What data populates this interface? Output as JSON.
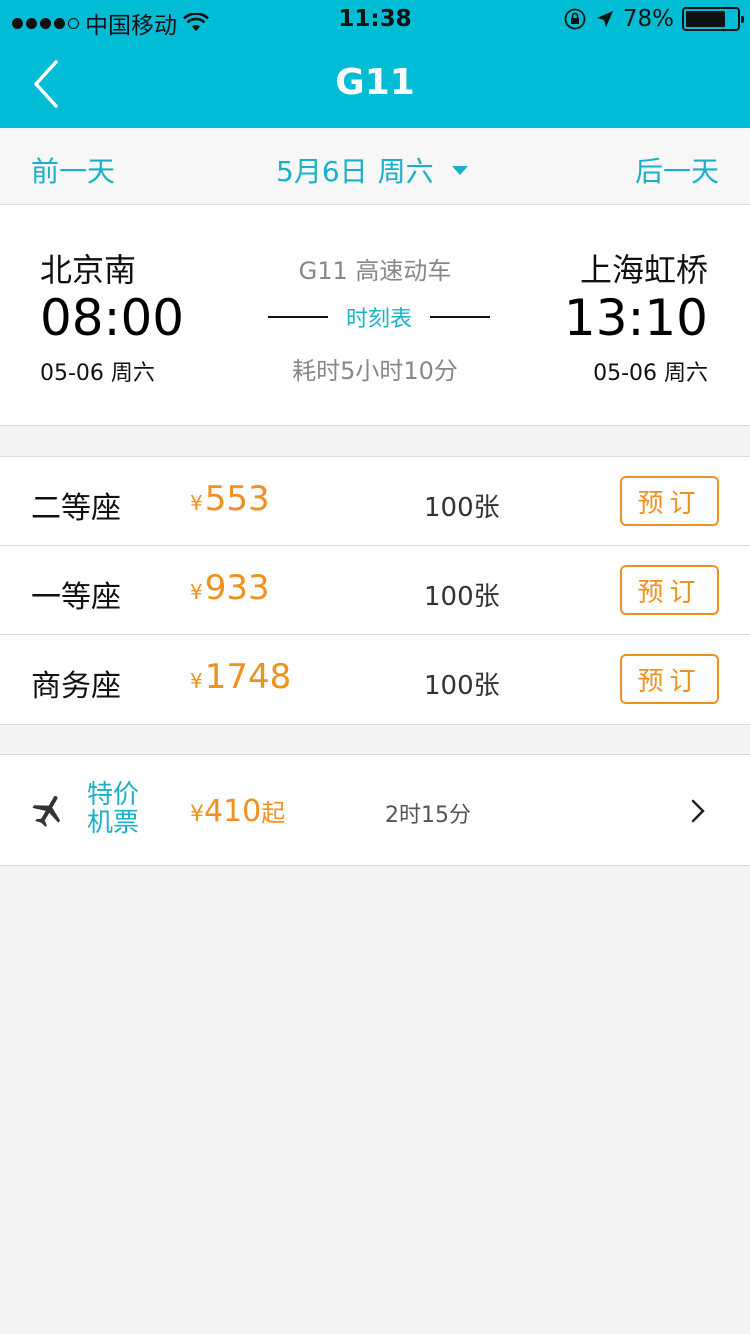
{
  "status_bar": {
    "carrier": "中国移动",
    "signal_bars_filled": 4,
    "signal_bars_total": 5,
    "time": "11:38",
    "battery_percent": "78%",
    "battery_level": 0.78,
    "icons": [
      "wifi-icon",
      "rotation-lock-icon",
      "location-arrow-icon",
      "battery-icon"
    ]
  },
  "navbar": {
    "title": "G11",
    "back_icon": "chevron-left-icon",
    "color": "#00bcd4"
  },
  "date_bar": {
    "prev_label": "前一天",
    "date_label": "5月6日",
    "weekday_label": "周六",
    "next_label": "后一天"
  },
  "trip": {
    "from": {
      "station": "北京南",
      "time": "08:00",
      "date": "05-06 周六"
    },
    "to": {
      "station": "上海虹桥",
      "time": "13:10",
      "date": "05-06 周六"
    },
    "train_info": "G11 高速动车",
    "timetable_label": "时刻表",
    "duration": "耗时5小时10分"
  },
  "seats": [
    {
      "name": "二等座",
      "currency": "¥",
      "price": "553",
      "count": "100张",
      "book_label": "预订"
    },
    {
      "name": "一等座",
      "currency": "¥",
      "price": "933",
      "count": "100张",
      "book_label": "预订"
    },
    {
      "name": "商务座",
      "currency": "¥",
      "price": "1748",
      "count": "100张",
      "book_label": "预订"
    }
  ],
  "flight": {
    "label_line1": "特价",
    "label_line2": "机票",
    "currency": "¥",
    "price": "410",
    "price_suffix": "起",
    "duration": "2时15分"
  },
  "colors": {
    "accent": "#00bcd4",
    "link": "#1ab0c8",
    "price": "#f0901e"
  }
}
